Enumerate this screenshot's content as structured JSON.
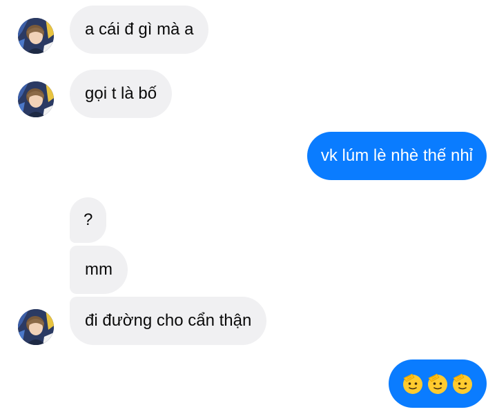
{
  "messages": [
    {
      "id": "m1",
      "direction": "incoming",
      "text": "a cái đ gì mà a"
    },
    {
      "id": "m2",
      "direction": "incoming",
      "text": "gọi t là bố"
    },
    {
      "id": "m3",
      "direction": "outgoing",
      "text": "vk lúm lè nhè thế nhỉ"
    },
    {
      "id": "m4",
      "direction": "incoming",
      "text": "?"
    },
    {
      "id": "m5",
      "direction": "incoming",
      "text": "mm"
    },
    {
      "id": "m6",
      "direction": "incoming",
      "text": "đi đường cho cẩn thận"
    },
    {
      "id": "m7",
      "direction": "outgoing",
      "text": "",
      "emoji": [
        "saluting-face-emoji",
        "saluting-face-emoji",
        "saluting-face-emoji"
      ]
    }
  ],
  "colors": {
    "incoming_bubble": "#f0f0f2",
    "outgoing_bubble": "#0a7cff",
    "incoming_text": "#0a0a0a",
    "outgoing_text": "#ffffff",
    "emoji_face": "#ffcb2f"
  }
}
